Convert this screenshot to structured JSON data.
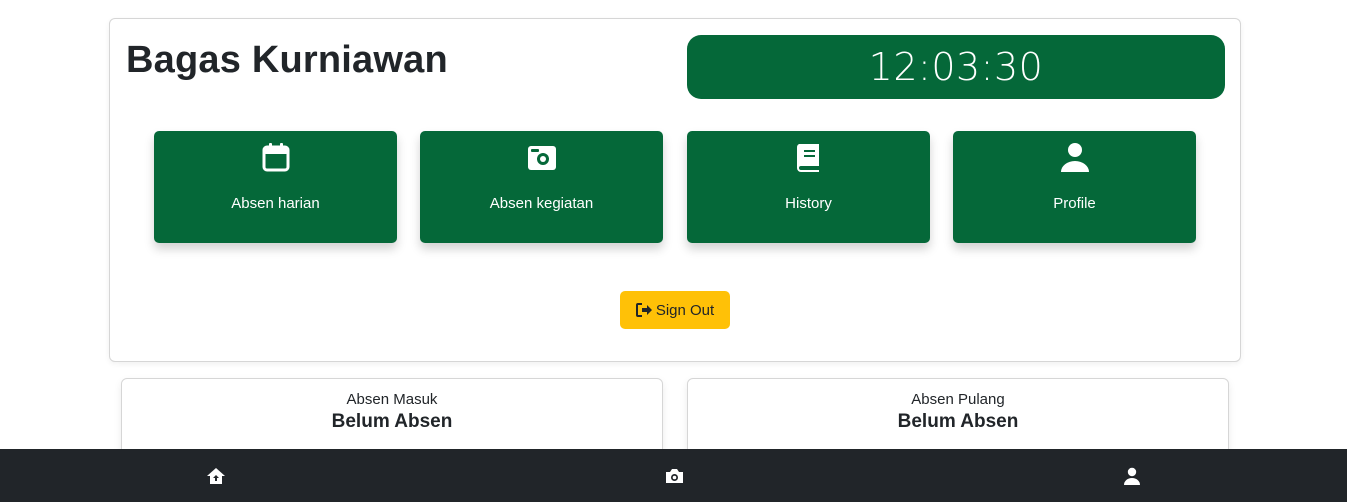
{
  "header": {
    "user_name": "Bagas Kurniawan",
    "clock": "12:03:30"
  },
  "menu": [
    {
      "label": "Absen harian",
      "icon": "calendar-icon"
    },
    {
      "label": "Absen kegiatan",
      "icon": "camera-icon"
    },
    {
      "label": "History",
      "icon": "book-icon"
    },
    {
      "label": "Profile",
      "icon": "user-icon"
    }
  ],
  "sign_out": {
    "label": "Sign Out",
    "icon": "sign-out-icon"
  },
  "attendance": {
    "masuk": {
      "label": "Absen Masuk",
      "value": "Belum Absen"
    },
    "pulang": {
      "label": "Absen Pulang",
      "value": "Belum Absen"
    }
  },
  "bottom_nav": [
    {
      "icon": "home-icon"
    },
    {
      "icon": "camera-icon"
    },
    {
      "icon": "user-icon"
    }
  ],
  "colors": {
    "primary": "#056839",
    "warning": "#ffc107",
    "nav_bg": "#212529"
  }
}
